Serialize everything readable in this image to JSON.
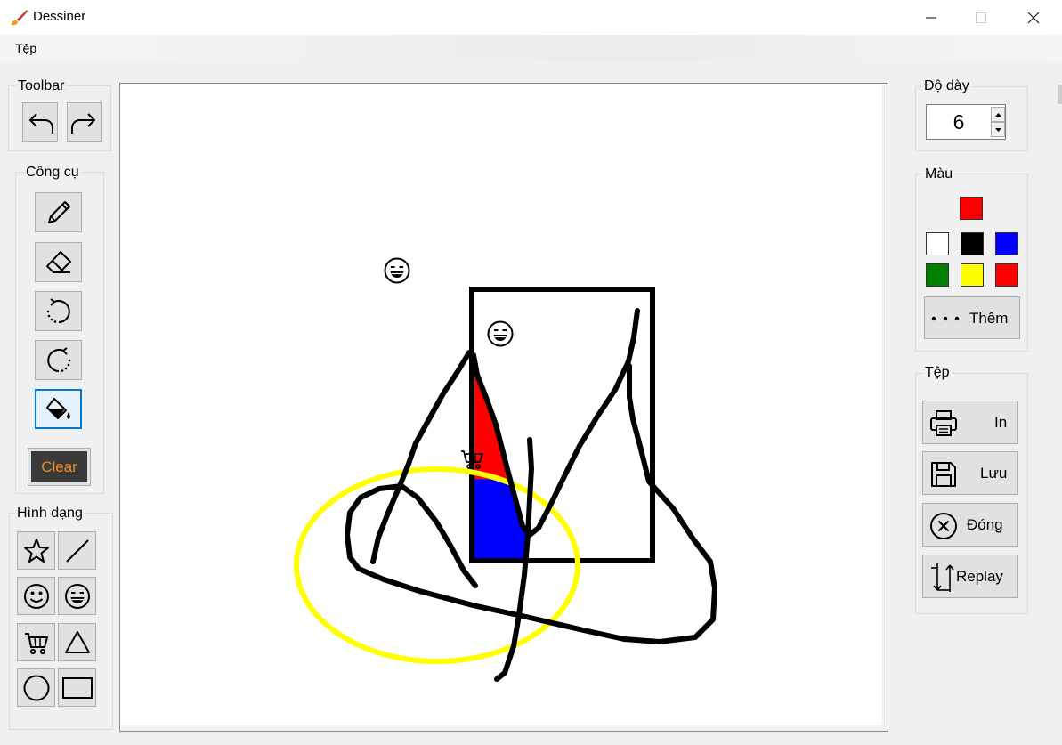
{
  "window": {
    "title": "Dessiner"
  },
  "menu": {
    "file": "Tệp"
  },
  "toolbar_group": {
    "title": "Toolbar",
    "undo_icon": "undo-arrow-icon",
    "redo_icon": "redo-arrow-icon"
  },
  "tools_group": {
    "title": "Công cụ",
    "tools": [
      "pencil-icon",
      "eraser-icon",
      "rotate-left-icon",
      "rotate-right-icon",
      "fill-bucket-icon"
    ],
    "selected_tool": "fill-bucket-icon",
    "clear_label": "Clear",
    "clear_color": "#f4891f"
  },
  "shapes_group": {
    "title": "Hình dạng",
    "shapes": [
      "star-icon",
      "line-icon",
      "smiley-icon",
      "grin-icon",
      "cart-icon",
      "triangle-icon",
      "circle-icon",
      "rectangle-icon"
    ]
  },
  "thickness_group": {
    "title": "Độ dày",
    "value": "6"
  },
  "color_group": {
    "title": "Màu",
    "current_color": "#ff0000",
    "palette": [
      "#ffffff",
      "#000000",
      "#0000ff",
      "#008000",
      "#ffff00",
      "#ff0000"
    ],
    "more_label": "Thêm"
  },
  "file_group": {
    "title": "Tệp",
    "print_label": "In",
    "save_label": "Lưu",
    "close_label": "Đóng",
    "replay_label": "Replay"
  },
  "canvas": {
    "stamps": [
      "grin-icon",
      "grin-icon",
      "cart-icon"
    ],
    "colors": {
      "stroke": "#000000",
      "ellipse": "#ffff00",
      "fill_red": "#ff0000",
      "fill_blue": "#0000ff"
    }
  }
}
